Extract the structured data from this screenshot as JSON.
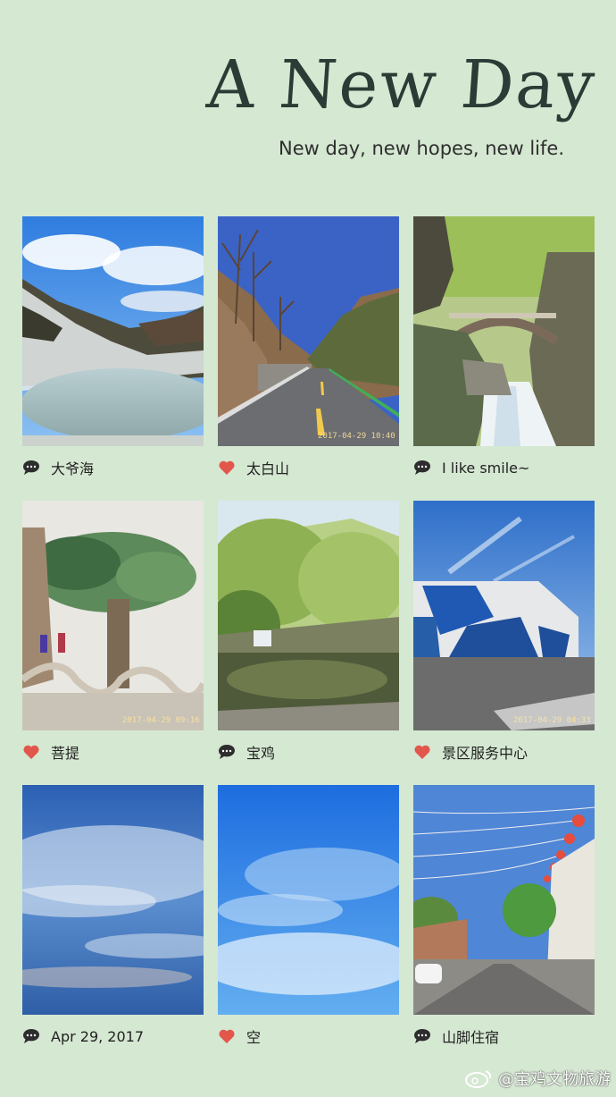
{
  "header": {
    "title": "A New Day",
    "subtitle": "New day, new hopes, new life."
  },
  "cards": [
    {
      "caption": "大爷海",
      "icon": "comment-icon"
    },
    {
      "caption": "太白山",
      "icon": "heart-icon",
      "timestamp": "2017-04-29 10:40"
    },
    {
      "caption": "I like smile~",
      "icon": "comment-icon"
    },
    {
      "caption": "菩提",
      "icon": "heart-icon",
      "timestamp": "2017-04-29 09:16"
    },
    {
      "caption": "宝鸡",
      "icon": "comment-icon"
    },
    {
      "caption": "景区服务中心",
      "icon": "heart-icon",
      "timestamp": "2017-04-29 04:33"
    },
    {
      "caption": "Apr 29, 2017",
      "icon": "comment-icon"
    },
    {
      "caption": "空",
      "icon": "heart-icon"
    },
    {
      "caption": "山脚住宿",
      "icon": "comment-icon"
    }
  ],
  "watermark": {
    "text": "@宝鸡文物旅游"
  },
  "colors": {
    "background": "#d5e8d2",
    "heart": "#e2574c",
    "comment": "#2d2d2d"
  }
}
